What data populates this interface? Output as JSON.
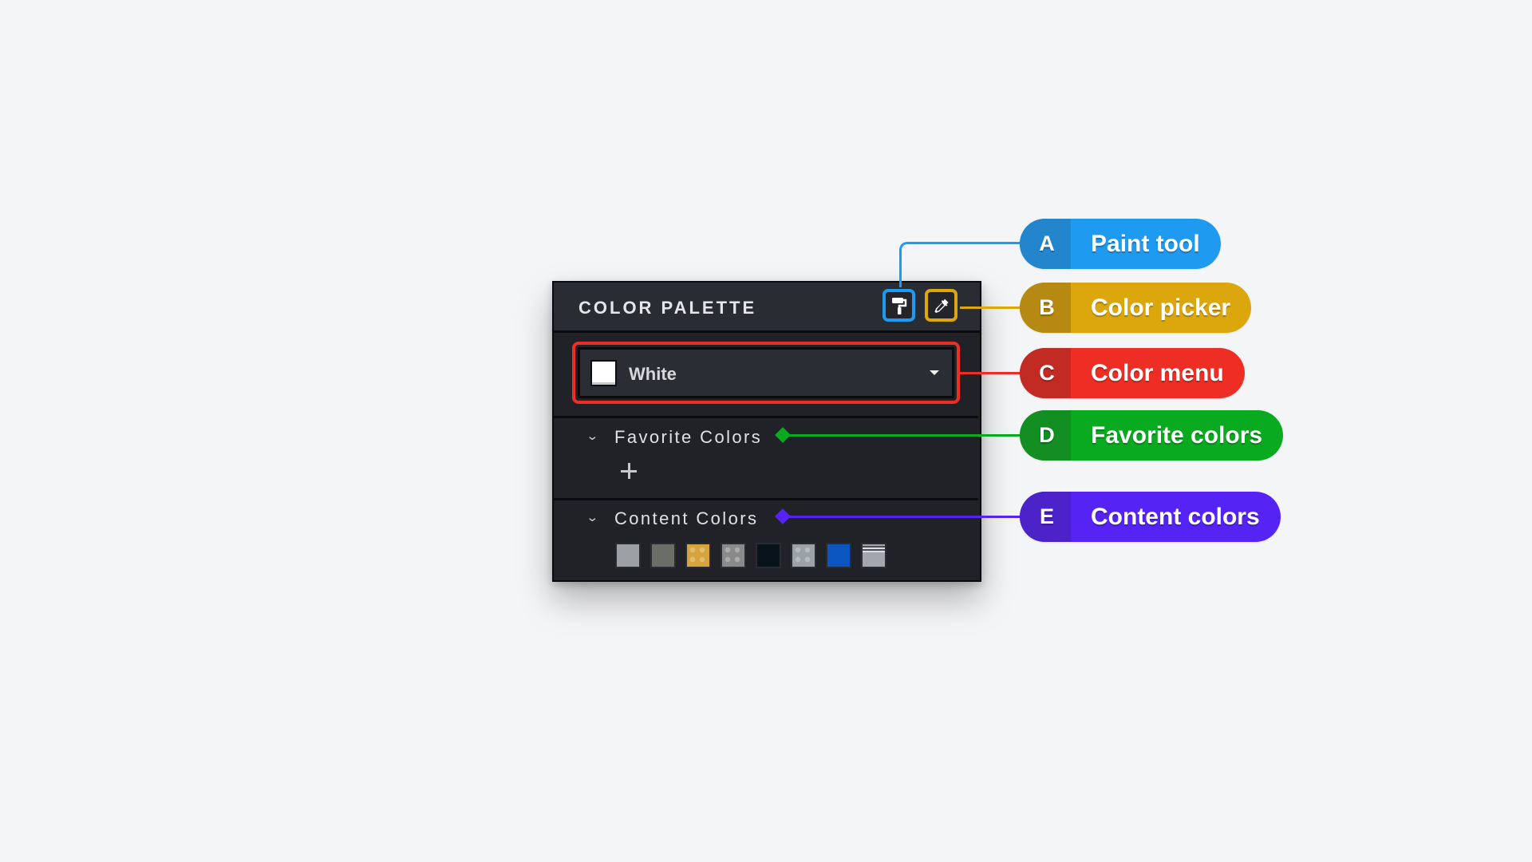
{
  "panel": {
    "title": "COLOR PALETTE",
    "tools": [
      {
        "name": "paint-tool",
        "icon": "paint-roller-icon"
      },
      {
        "name": "color-picker",
        "icon": "eyedropper-icon"
      }
    ],
    "color_menu": {
      "selected": "White",
      "swatch_color": "#ffffff"
    },
    "sections": [
      {
        "title": "Favorite Colors",
        "expanded": true,
        "add_label": "+"
      },
      {
        "title": "Content Colors",
        "expanded": true
      }
    ],
    "content_colors": [
      {
        "color": "#9da1a4",
        "pattern": "solid"
      },
      {
        "color": "#6a6e66",
        "pattern": "solid"
      },
      {
        "color": "#d6a43c",
        "pattern": "dotted"
      },
      {
        "color": "#8b8a8b",
        "pattern": "dotted"
      },
      {
        "color": "#08131b",
        "pattern": "solid"
      },
      {
        "color": "#9ba2a8",
        "pattern": "dotted"
      },
      {
        "color": "#0c56c2",
        "pattern": "solid"
      },
      {
        "color": "#a3a6ae",
        "pattern": "striped"
      }
    ]
  },
  "callouts": [
    {
      "letter": "A",
      "label": "Paint tool",
      "color": "#1e9bf0",
      "letter_bg": "#2386cc"
    },
    {
      "letter": "B",
      "label": "Color picker",
      "color": "#dca70c",
      "letter_bg": "#b58912"
    },
    {
      "letter": "C",
      "label": "Color menu",
      "color": "#ee2e24",
      "letter_bg": "#c12b24"
    },
    {
      "letter": "D",
      "label": "Favorite colors",
      "color": "#0aaa20",
      "letter_bg": "#128e22"
    },
    {
      "letter": "E",
      "label": "Content colors",
      "color": "#5524f5",
      "letter_bg": "#4b23c8"
    }
  ]
}
